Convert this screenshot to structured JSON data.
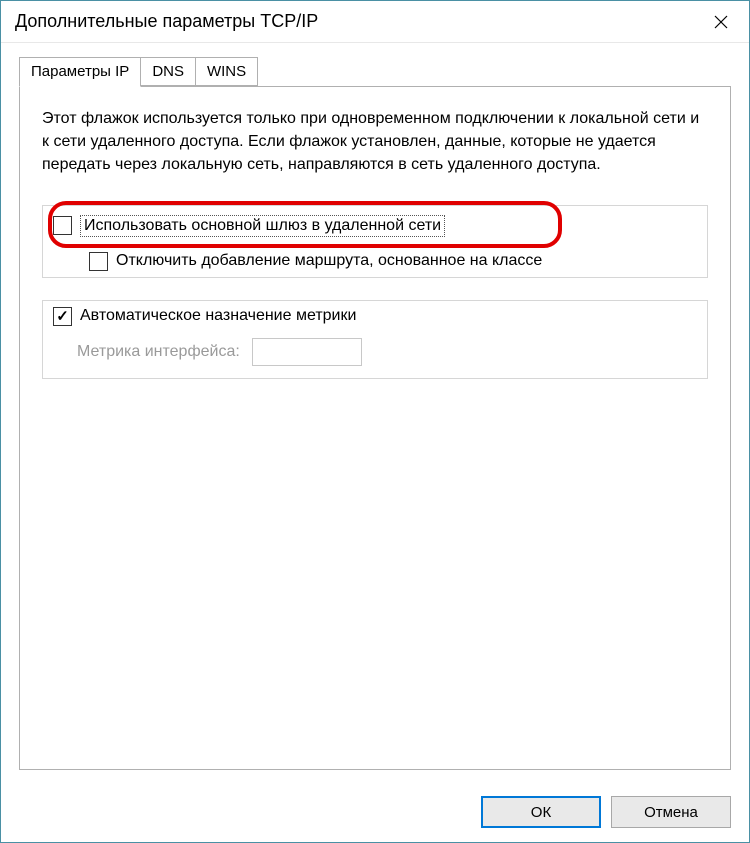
{
  "window": {
    "title": "Дополнительные параметры TCP/IP"
  },
  "tabs": {
    "items": [
      {
        "label": "Параметры IP",
        "active": true
      },
      {
        "label": "DNS",
        "active": false
      },
      {
        "label": "WINS",
        "active": false
      }
    ]
  },
  "panel": {
    "description": "Этот флажок используется только при одновременном подключении к локальной сети и к сети удаленного доступа. Если флажок установлен, данные, которые не удается передать через локальную сеть, направляются в сеть удаленного доступа.",
    "checkbox_gateway": {
      "label": "Использовать основной шлюз в удаленной сети",
      "checked": false
    },
    "checkbox_class_route": {
      "label": "Отключить добавление маршрута, основанное на классе",
      "checked": false
    },
    "checkbox_auto_metric": {
      "label": "Автоматическое назначение метрики",
      "checked": true
    },
    "metric_field": {
      "label": "Метрика интерфейса:",
      "value": ""
    }
  },
  "buttons": {
    "ok": "ОК",
    "cancel": "Отмена"
  }
}
